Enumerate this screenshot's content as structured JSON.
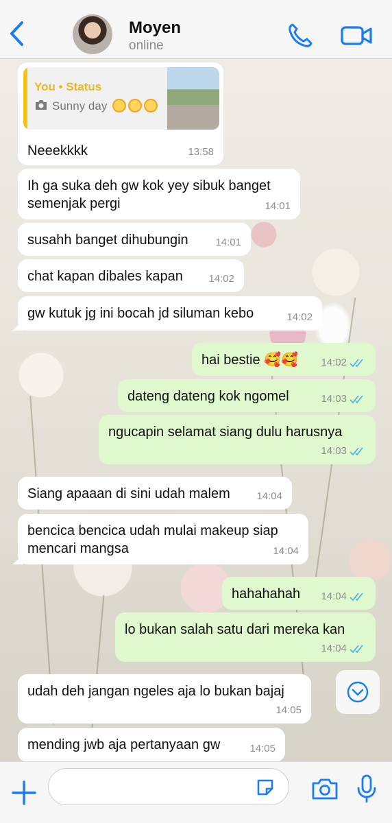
{
  "header": {
    "contact_name": "Moyen",
    "contact_status": "online",
    "icons": {
      "back": "chevron-left-icon",
      "call": "phone-icon",
      "video": "video-camera-icon"
    }
  },
  "status_reply": {
    "title": "You • Status",
    "caption": "Sunny day",
    "time": "13:58"
  },
  "messages": [
    {
      "dir": "in",
      "text": "Neeekkkk",
      "time": "13:58"
    },
    {
      "dir": "in",
      "text": "Ih ga suka deh gw kok yey sibuk banget\nsemenjak pergi",
      "time": "14:01"
    },
    {
      "dir": "in",
      "text": "susahh banget dihubungin",
      "time": "14:01"
    },
    {
      "dir": "in",
      "text": "chat kapan dibales kapan",
      "time": "14:02"
    },
    {
      "dir": "in",
      "text": "gw kutuk jg ini bocah jd siluman kebo",
      "time": "14:02"
    },
    {
      "dir": "out",
      "text": "hai bestie 🥰🥰",
      "time": "14:02"
    },
    {
      "dir": "out",
      "text": "dateng dateng kok ngomel",
      "time": "14:03"
    },
    {
      "dir": "out",
      "text": "ngucapin selamat siang dulu harusnya",
      "time": "14:03"
    },
    {
      "dir": "in",
      "text": "Siang apaaan di sini udah malem",
      "time": "14:04"
    },
    {
      "dir": "in",
      "text": "bencica bencica udah mulai makeup siap\nmencari mangsa",
      "time": "14:04"
    },
    {
      "dir": "out",
      "text": "hahahahah",
      "time": "14:04"
    },
    {
      "dir": "out",
      "text": "lo bukan salah satu dari mereka kan",
      "time": "14:04"
    },
    {
      "dir": "in",
      "text": "udah deh jangan ngeles aja lo bukan bajaj",
      "time": "14:05"
    },
    {
      "dir": "in",
      "text": "mending jwb aja pertanyaan gw",
      "time": "14:05"
    }
  ],
  "composer": {
    "value": "",
    "icons": {
      "plus": "plus-icon",
      "sticker": "sticker-icon",
      "camera": "camera-icon",
      "mic": "microphone-icon"
    }
  },
  "colors": {
    "accent": "#1a7cf5",
    "incoming_bubble": "#ffffff",
    "outgoing_bubble": "#dff8cd",
    "status_accent": "#f2c318",
    "read_ticks": "#4fb2f1"
  }
}
